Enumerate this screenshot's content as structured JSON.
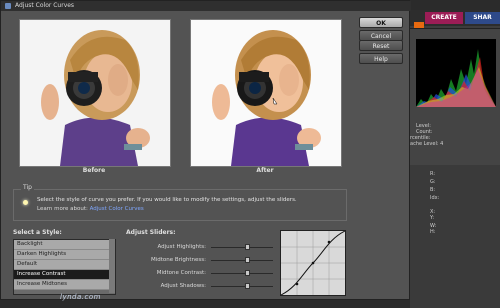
{
  "dialog": {
    "title": "Adjust Color Curves",
    "buttons": {
      "ok": "OK",
      "cancel": "Cancel",
      "reset": "Reset",
      "help": "Help"
    },
    "previews": {
      "before_label": "Before",
      "after_label": "After"
    },
    "tip": {
      "title": "Tip",
      "text": "Select the style of curve you prefer. If you would like to modify the settings, adjust the sliders.",
      "more_prefix": "Learn more about:",
      "more_link": "Adjust Color Curves"
    },
    "style_section": {
      "label": "Select a Style:",
      "items": [
        "Backlight",
        "Darken Highlights",
        "Default",
        "Increase Contrast",
        "Increase Midtones"
      ],
      "selected_index": 3
    },
    "sliders_section": {
      "label": "Adjust Sliders:",
      "sliders": [
        {
          "label": "Adjust Highlights:",
          "value": 0.58
        },
        {
          "label": "Midtone Brightness:",
          "value": 0.58
        },
        {
          "label": "Midtone Contrast:",
          "value": 0.58
        },
        {
          "label": "Adjust Shadows:",
          "value": 0.58
        }
      ]
    }
  },
  "right_panel": {
    "tabs": {
      "create": "CREATE",
      "share": "SHAR"
    },
    "info": {
      "level": "Level:",
      "count": "Count:",
      "centile": "rcentile:",
      "cache": "ache Level: 4"
    },
    "channels": [
      "R:",
      "G:",
      "B:",
      "Idx:"
    ],
    "extra": [
      "X:",
      "Y:",
      "W:",
      "H:"
    ]
  },
  "watermark": "lynda.com"
}
